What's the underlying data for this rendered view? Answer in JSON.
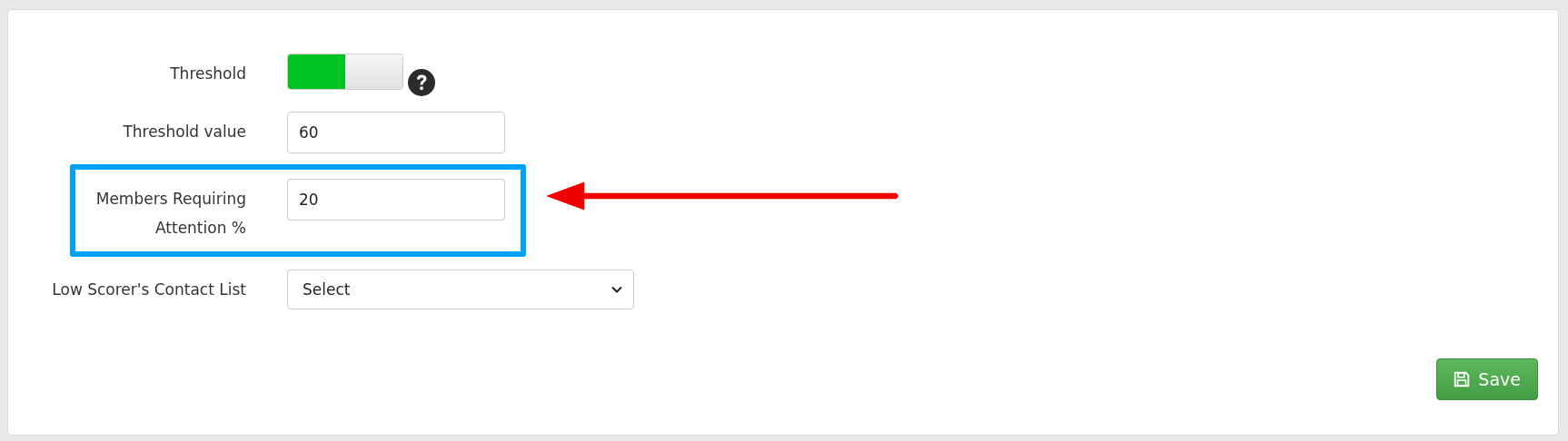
{
  "form": {
    "fields": [
      {
        "kind": "toggle",
        "label": "Threshold",
        "on": true,
        "help": true
      },
      {
        "kind": "input",
        "label": "Threshold value",
        "value": "60",
        "highlighted": false
      },
      {
        "kind": "input",
        "label": "Members Requiring Attention %",
        "value": "20",
        "highlighted": true
      },
      {
        "kind": "select",
        "label": "Low Scorer's Contact List",
        "value": "Select"
      }
    ]
  },
  "save_button": {
    "label": "Save"
  }
}
